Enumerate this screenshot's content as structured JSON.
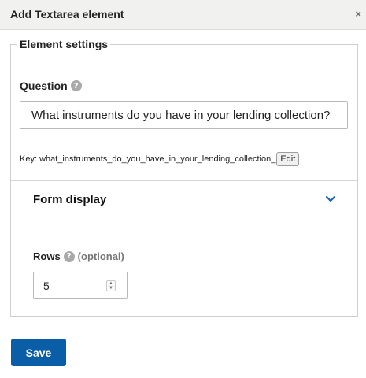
{
  "dialog": {
    "title": "Add Textarea element",
    "close_label": "×"
  },
  "element_settings": {
    "legend": "Element settings",
    "question": {
      "label": "Question",
      "help_icon": "?",
      "value": "What instruments do you have in your lending collection?"
    },
    "key": {
      "text": "Key: what_instruments_do_you_have_in_your_lending_collection_",
      "edit_label": "Edit"
    }
  },
  "form_display": {
    "title": "Form display",
    "toggle_icon": "chevron-down-icon",
    "rows": {
      "label": "Rows",
      "help_icon": "?",
      "optional_label": "(optional)",
      "value": "5"
    }
  },
  "actions": {
    "save_label": "Save"
  },
  "colors": {
    "primary": "#0a5ea8",
    "header_bg": "#f1f1ef",
    "chevron": "#1f63b3"
  }
}
